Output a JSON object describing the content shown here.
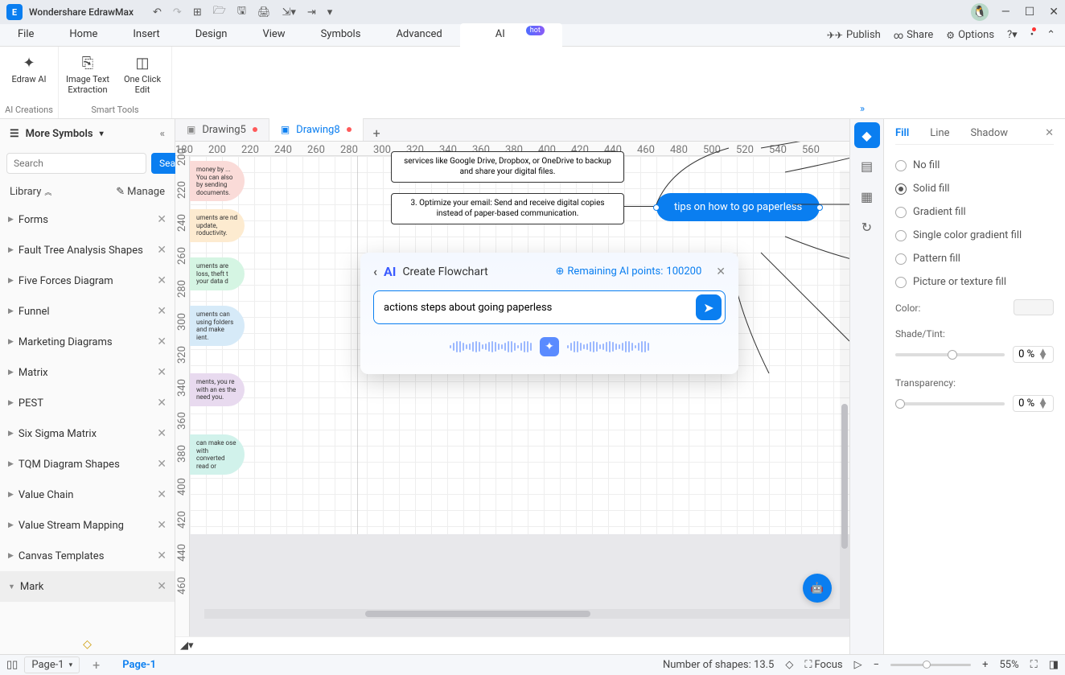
{
  "app": {
    "name": "Wondershare EdrawMax"
  },
  "qat": [
    "↶",
    "↷",
    "⊞",
    "🗁",
    "🖫",
    "🖨",
    "⇲",
    "▾",
    "⇥",
    "▾"
  ],
  "menus": [
    "File",
    "Home",
    "Insert",
    "Design",
    "View",
    "Symbols",
    "Advanced"
  ],
  "ai_menu": {
    "label": "AI",
    "badge": "hot"
  },
  "menubar_right": {
    "publish": "Publish",
    "share": "Share",
    "options": "Options"
  },
  "ribbon": {
    "group1": {
      "label": "AI Creations",
      "items": [
        {
          "icon": "✦",
          "text": "Edraw AI"
        }
      ]
    },
    "group2": {
      "label": "Smart Tools",
      "items": [
        {
          "icon": "⎘",
          "text": "Image Text Extraction"
        },
        {
          "icon": "◫",
          "text": "One Click Edit"
        }
      ]
    }
  },
  "left": {
    "header": "More Symbols",
    "search_placeholder": "Search",
    "search_btn": "Search",
    "library": "Library",
    "manage": "Manage",
    "cats": [
      {
        "name": "Forms",
        "open": false
      },
      {
        "name": "Fault Tree Analysis Shapes",
        "open": false
      },
      {
        "name": "Five Forces Diagram",
        "open": false
      },
      {
        "name": "Funnel",
        "open": false
      },
      {
        "name": "Marketing Diagrams",
        "open": false
      },
      {
        "name": "Matrix",
        "open": false
      },
      {
        "name": "PEST",
        "open": false
      },
      {
        "name": "Six Sigma Matrix",
        "open": false
      },
      {
        "name": "TQM Diagram Shapes",
        "open": false
      },
      {
        "name": "Value Chain",
        "open": false
      },
      {
        "name": "Value Stream Mapping",
        "open": false
      },
      {
        "name": "Canvas Templates",
        "open": false
      },
      {
        "name": "Mark",
        "open": true
      }
    ]
  },
  "tabs": [
    {
      "name": "Drawing5",
      "active": false,
      "dirty": true
    },
    {
      "name": "Drawing8",
      "active": true,
      "dirty": true
    }
  ],
  "ruler_h": [
    180,
    200,
    220,
    240,
    260,
    280,
    300,
    320,
    340,
    360,
    380,
    400,
    420,
    440,
    460,
    480,
    500,
    520,
    540,
    560
  ],
  "ruler_v": [
    200,
    220,
    240,
    260,
    280,
    300,
    320,
    340,
    360,
    380,
    400,
    420,
    440,
    460
  ],
  "canvas": {
    "box1": "services like Google Drive, Dropbox, or OneDrive to backup and share your digital files.",
    "box2": "3. Optimize your email: Send and receive digital copies instead of paper-based communication.",
    "main_shape": "tips on how to go paperless",
    "partials": [
      "money by ... You can also by sending documents.",
      "uments are nd update, roductivity.",
      "uments are loss, theft t your data d",
      "uments can using folders and make ient.",
      "ments, you re with an es the need you.",
      "can make ose with converted read or"
    ]
  },
  "ai_dlg": {
    "title": "Create Flowchart",
    "points_label": "Remaining AI points:",
    "points_value": "100200",
    "input": "actions steps about going paperless"
  },
  "rpanel": {
    "tabs": [
      "Fill",
      "Line",
      "Shadow"
    ],
    "radios": [
      "No fill",
      "Solid fill",
      "Gradient fill",
      "Single color gradient fill",
      "Pattern fill",
      "Picture or texture fill"
    ],
    "selected_radio": 1,
    "color_label": "Color:",
    "shade_label": "Shade/Tint:",
    "shade_value": "0 %",
    "trans_label": "Transparency:",
    "trans_value": "0 %"
  },
  "status": {
    "page_sel": "Page-1",
    "page_tab": "Page-1",
    "shapes": "Number of shapes: 13.5",
    "focus": "Focus",
    "zoom": "55%"
  },
  "colors": [
    "#fff",
    "#fdd",
    "#fbb",
    "#f99",
    "#f77",
    "#f55",
    "#f33",
    "#f11",
    "#e0f",
    "#c0f",
    "#a0f",
    "#80f",
    "#60f",
    "#40f",
    "#20f",
    "#00f",
    "#02f",
    "#05f",
    "#08f",
    "#0bf",
    "#0df",
    "#0ff",
    "#0fd",
    "#0fb",
    "#0f8",
    "#0f5",
    "#0f2",
    "#0f0",
    "#2f0",
    "#5f0",
    "#8f0",
    "#bf0",
    "#df0",
    "#ff0",
    "#fd0",
    "#fb0",
    "#f80",
    "#f50",
    "#f20",
    "#f00",
    "#e00",
    "#c00",
    "#a00",
    "#800",
    "#600",
    "#400",
    "#fec",
    "#edc",
    "#dcb",
    "#cba",
    "#ba9",
    "#a98",
    "#987",
    "#876",
    "#765",
    "#654",
    "#543",
    "#432",
    "#321",
    "#210",
    "#eee",
    "#ccc",
    "#aaa",
    "#888",
    "#666",
    "#444",
    "#222",
    "#000",
    "#000",
    "#000"
  ]
}
